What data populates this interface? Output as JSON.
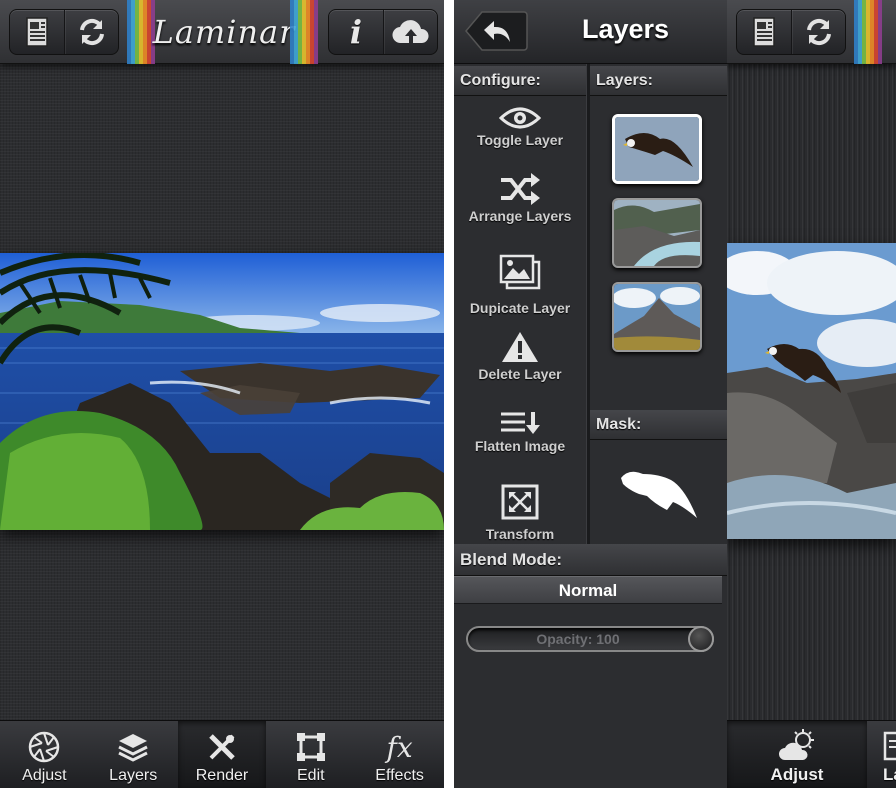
{
  "main_screen": {
    "logo": "Laminar",
    "tabs": [
      {
        "label": "Adjust",
        "icon": "aperture-icon"
      },
      {
        "label": "Layers",
        "icon": "layers-icon"
      },
      {
        "label": "Render",
        "icon": "render-tools-icon"
      },
      {
        "label": "Edit",
        "icon": "crop-icon"
      },
      {
        "label": "Effects",
        "icon": "fx-icon"
      }
    ]
  },
  "layers_panel": {
    "title": "Layers",
    "configure_heading": "Configure:",
    "layers_heading": "Layers:",
    "mask_heading": "Mask:",
    "blend_heading": "Blend Mode:",
    "blend_value": "Normal",
    "opacity_text": "Opacity: 100",
    "opacity": 100,
    "configure_items": [
      {
        "label": "Toggle Layer",
        "icon": "eye-icon"
      },
      {
        "label": "Arrange Layers",
        "icon": "shuffle-icon"
      },
      {
        "label": "Dupicate Layer",
        "icon": "duplicate-image-icon"
      },
      {
        "label": "Delete Layer",
        "icon": "warning-icon"
      },
      {
        "label": "Flatten Image",
        "icon": "flatten-icon"
      },
      {
        "label": "Transform",
        "icon": "transform-icon"
      }
    ],
    "layer_thumbnails": [
      {
        "content": "eagle",
        "selected": true
      },
      {
        "content": "river",
        "selected": false
      },
      {
        "content": "mountain",
        "selected": false
      }
    ]
  },
  "right_screen": {
    "active_tab_label": "Adjust",
    "partial_tab_label": "La"
  },
  "colors": {
    "accent_white": "#ffffff",
    "toolbar_dark": "#2f3033",
    "background": "#2c2d30"
  }
}
